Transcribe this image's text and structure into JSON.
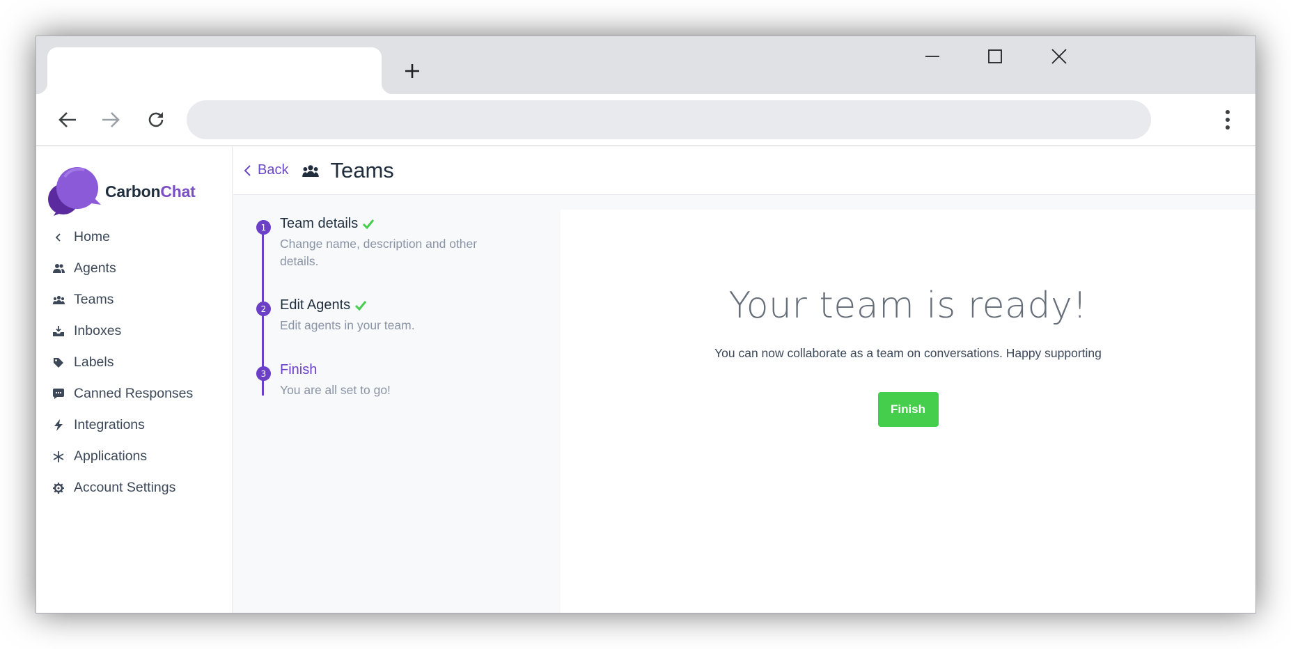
{
  "browser": {
    "tab_title": "",
    "address": "",
    "icons": [
      "new-tab-icon",
      "minimize-icon",
      "maximize-icon",
      "close-icon",
      "back-arrow-icon",
      "forward-arrow-icon",
      "reload-icon",
      "more-vert-icon"
    ]
  },
  "brand": {
    "name_main": "Carbon",
    "name_accent": "Chat"
  },
  "sidebar": {
    "items": [
      {
        "label": "Home",
        "icon": "chevron-left-icon"
      },
      {
        "label": "Agents",
        "icon": "users-icon"
      },
      {
        "label": "Teams",
        "icon": "teams-icon"
      },
      {
        "label": "Inboxes",
        "icon": "inbox-icon"
      },
      {
        "label": "Labels",
        "icon": "tag-icon"
      },
      {
        "label": "Canned Responses",
        "icon": "chat-bubble-icon"
      },
      {
        "label": "Integrations",
        "icon": "lightning-icon"
      },
      {
        "label": "Applications",
        "icon": "asterisk-icon"
      },
      {
        "label": "Account Settings",
        "icon": "gear-icon"
      }
    ]
  },
  "header": {
    "back_label": "Back",
    "title": "Teams"
  },
  "steps": [
    {
      "number": "1",
      "title": "Team details",
      "description": "Change name, description and other details.",
      "complete": true
    },
    {
      "number": "2",
      "title": "Edit Agents",
      "description": "Edit agents in your team.",
      "complete": true
    },
    {
      "number": "3",
      "title": "Finish",
      "description": "You are all set to go!",
      "complete": false
    }
  ],
  "content": {
    "heading": "Your team is ready!",
    "message": "You can now collaborate as a team on conversations. Happy supporting",
    "finish_button": "Finish"
  },
  "colors": {
    "accent": "#6b3fc6",
    "success": "#44ce4b",
    "text": "#1f2d3d",
    "muted": "#8a94a5"
  }
}
